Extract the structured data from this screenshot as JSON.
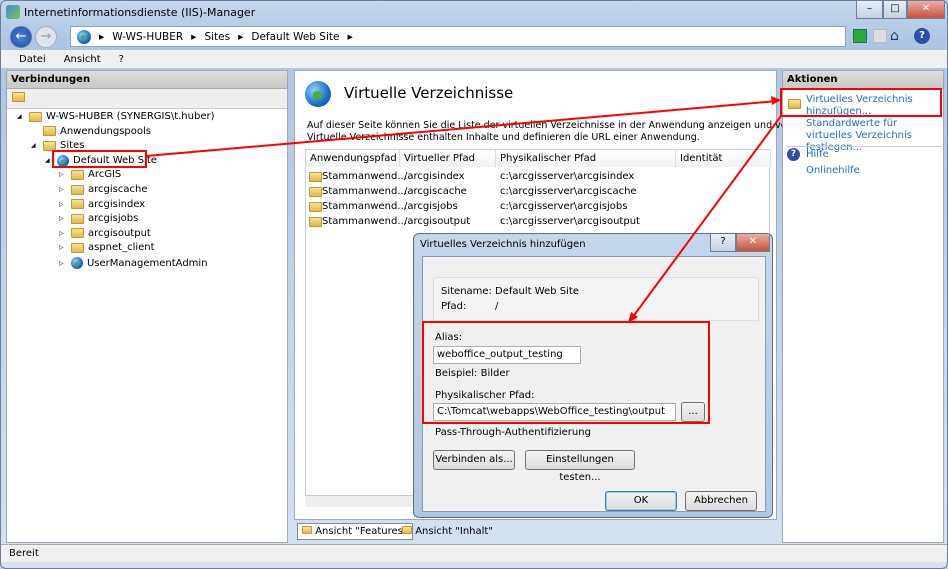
{
  "window": {
    "title": "Internetinformationsdienste (IIS)-Manager",
    "minimize": "–",
    "maximize": "□",
    "close": "✕"
  },
  "breadcrumb": [
    "W-WS-HUBER",
    "Sites",
    "Default Web Site"
  ],
  "menu": [
    "Datei",
    "Ansicht",
    "?"
  ],
  "connections": {
    "title": "Verbindungen",
    "tree": [
      {
        "label": "W-WS-HUBER (SYNERGIS\\t.huber)",
        "level": 0,
        "icon": "server-icon"
      },
      {
        "label": "Anwendungspools",
        "level": 1,
        "icon": "app-pool-icon"
      },
      {
        "label": "Sites",
        "level": 1,
        "icon": "sites-folder-icon"
      },
      {
        "label": "Default Web Site",
        "level": 2,
        "icon": "globe-icon",
        "selected": true
      },
      {
        "label": "ArcGIS",
        "level": 3,
        "icon": "folder-icon"
      },
      {
        "label": "arcgiscache",
        "level": 3,
        "icon": "folder-icon"
      },
      {
        "label": "arcgisindex",
        "level": 3,
        "icon": "folder-icon"
      },
      {
        "label": "arcgisjobs",
        "level": 3,
        "icon": "folder-icon"
      },
      {
        "label": "arcgisoutput",
        "level": 3,
        "icon": "folder-icon"
      },
      {
        "label": "aspnet_client",
        "level": 3,
        "icon": "folder-icon"
      },
      {
        "label": "UserManagementAdmin",
        "level": 3,
        "icon": "app-icon"
      }
    ]
  },
  "main": {
    "title": "Virtuelle Verzeichnisse",
    "description1": "Auf dieser Seite können Sie die Liste der virtuellen Verzeichnisse in der Anwendung anzeigen und verwalten.",
    "description2": "Virtuelle Verzeichnisse enthalten Inhalte und definieren die URL einer Anwendung.",
    "columns": [
      "Anwendungspfad",
      "Virtueller Pfad",
      "Physikalischer Pfad",
      "Identität"
    ],
    "rows": [
      [
        "Stammanwend...",
        "/arcgisindex",
        "c:\\arcgisserver\\arcgisindex",
        ""
      ],
      [
        "Stammanwend...",
        "/arcgiscache",
        "c:\\arcgisserver\\arcgiscache",
        ""
      ],
      [
        "Stammanwend...",
        "/arcgisjobs",
        "c:\\arcgisserver\\arcgisjobs",
        ""
      ],
      [
        "Stammanwend...",
        "/arcgisoutput",
        "c:\\arcgisserver\\arcgisoutput",
        ""
      ]
    ],
    "tabs": [
      "Ansicht \"Features\"",
      "Ansicht \"Inhalt\""
    ]
  },
  "actions": {
    "title": "Aktionen",
    "add": "Virtuelles Verzeichnis hinzufügen...",
    "defaults": "Standardwerte für virtuelles Verzeichnis festlegen...",
    "help": "Hilfe",
    "online_help": "Onlinehilfe"
  },
  "dialog": {
    "title": "Virtuelles Verzeichnis hinzufügen",
    "help": "?",
    "close": "✕",
    "sitename_label": "Sitename:",
    "sitename": "Default Web Site",
    "path_label": "Pfad:",
    "path": "/",
    "alias_label": "Alias:",
    "alias": "weboffice_output_testing",
    "example": "Beispiel: Bilder",
    "physical_label": "Physikalischer Pfad:",
    "physical": "C:\\Tomcat\\webapps\\WebOffice_testing\\output",
    "browse": "...",
    "passthrough": "Pass-Through-Authentifizierung",
    "connect_as": "Verbinden als...",
    "test": "Einstellungen testen...",
    "ok": "OK",
    "cancel": "Abbrechen"
  },
  "status": "Bereit",
  "colors": {
    "annotation": "#ff0000",
    "link": "#1e6fc8"
  }
}
